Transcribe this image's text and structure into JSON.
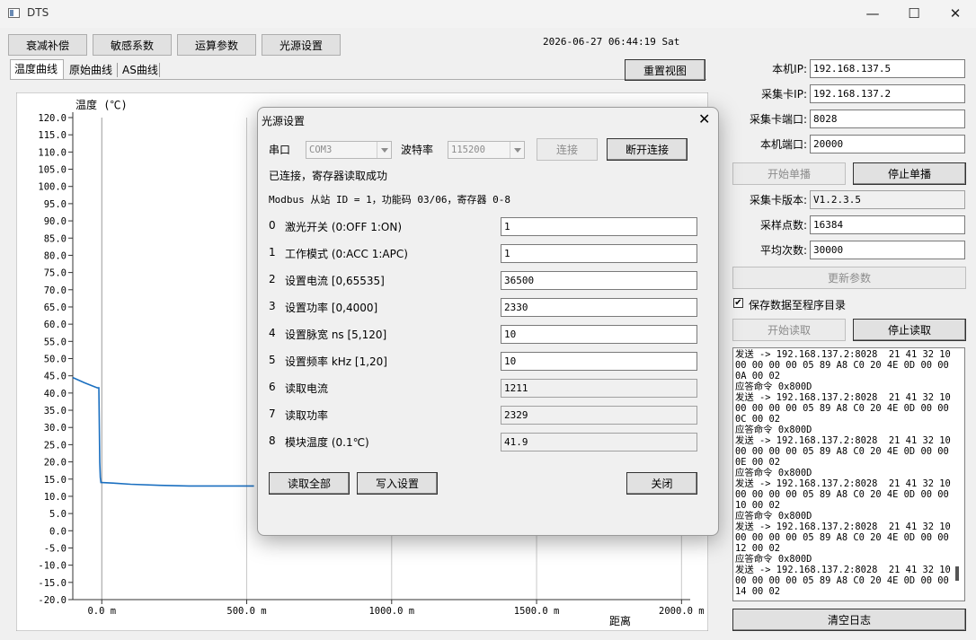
{
  "window": {
    "title": "DTS",
    "minimize": "—",
    "maximize": "☐",
    "close": "✕"
  },
  "toolbar": {
    "buttons": [
      "衰减补偿",
      "敏感系数",
      "运算参数",
      "光源设置"
    ],
    "datetime": "2026-06-27 06:44:19 Sat",
    "reset_view": "重置视图"
  },
  "tabs": [
    "温度曲线",
    "原始曲线",
    "AS曲线"
  ],
  "chart_data": {
    "type": "line",
    "ylabel": "温度 (℃)",
    "xlabel": "距离",
    "ylim": [
      -20,
      120
    ],
    "xlim": [
      -100,
      2030
    ],
    "yticks": [
      "120.0",
      "115.0",
      "110.0",
      "105.0",
      "100.0",
      "95.0",
      "90.0",
      "85.0",
      "80.0",
      "75.0",
      "70.0",
      "65.0",
      "60.0",
      "55.0",
      "50.0",
      "45.0",
      "40.0",
      "35.0",
      "30.0",
      "25.0",
      "20.0",
      "15.0",
      "10.0",
      "5.0",
      "0.0",
      "-5.0",
      "-10.0",
      "-15.0",
      "-20.0"
    ],
    "xticks": [
      {
        "value": 0,
        "label": "0.0 m"
      },
      {
        "value": 500,
        "label": "500.0 m"
      },
      {
        "value": 1000,
        "label": "1000.0 m"
      },
      {
        "value": 1500,
        "label": "1500.0 m"
      },
      {
        "value": 2000,
        "label": "2000.0 m"
      }
    ],
    "series_color": "#1a6fc0",
    "series": [
      {
        "x": [
          -100,
          -60,
          -30,
          -15,
          -10,
          -7,
          -5,
          -3,
          0,
          50,
          100,
          200,
          300,
          400,
          500,
          525
        ],
        "y": [
          44.5,
          43,
          42,
          41.5,
          41.5,
          20,
          15.5,
          14,
          14,
          13.8,
          13.5,
          13.2,
          13.0,
          13.0,
          13.0,
          13.0
        ]
      }
    ]
  },
  "right_panel": {
    "local_ip_label": "本机IP:",
    "local_ip": "192.168.137.5",
    "card_ip_label": "采集卡IP:",
    "card_ip": "192.168.137.2",
    "card_port_label": "采集卡端口:",
    "card_port": "8028",
    "local_port_label": "本机端口:",
    "local_port": "20000",
    "start_single": "开始单播",
    "stop_single": "停止单播",
    "card_version_label": "采集卡版本:",
    "card_version": "V1.2.3.5",
    "sample_points_label": "采样点数:",
    "sample_points": "16384",
    "avg_count_label": "平均次数:",
    "avg_count": "30000",
    "update_params": "更新参数",
    "save_checkbox_label": "保存数据至程序目录",
    "start_read": "开始读取",
    "stop_read": "停止读取",
    "log_lines": [
      "发送 -> 192.168.137.2:8028  21 41 32 10",
      "00 00 00 00 05 89 A8 C0 20 4E 0D 00 00",
      "0A 00 02",
      "应答命令 0x800D",
      "发送 -> 192.168.137.2:8028  21 41 32 10",
      "00 00 00 00 05 89 A8 C0 20 4E 0D 00 00",
      "0C 00 02",
      "应答命令 0x800D",
      "发送 -> 192.168.137.2:8028  21 41 32 10",
      "00 00 00 00 05 89 A8 C0 20 4E 0D 00 00",
      "0E 00 02",
      "应答命令 0x800D",
      "发送 -> 192.168.137.2:8028  21 41 32 10",
      "00 00 00 00 05 89 A8 C0 20 4E 0D 00 00",
      "10 00 02",
      "应答命令 0x800D",
      "发送 -> 192.168.137.2:8028  21 41 32 10",
      "00 00 00 00 05 89 A8 C0 20 4E 0D 00 00",
      "12 00 02",
      "应答命令 0x800D",
      "发送 -> 192.168.137.2:8028  21 41 32 10",
      "00 00 00 00 05 89 A8 C0 20 4E 0D 00 00",
      "14 00 02"
    ],
    "clear_log": "清空日志"
  },
  "dialog": {
    "title": "光源设置",
    "close_icon": "✕",
    "port_label": "串口",
    "port_value": "COM3",
    "baud_label": "波特率",
    "baud_value": "115200",
    "connect": "连接",
    "disconnect": "断开连接",
    "status": "已连接，寄存器读取成功",
    "modbus_info": "Modbus 从站 ID = 1，功能码 03/06，寄存器 0-8",
    "registers": [
      {
        "index": "0",
        "name": "激光开关 (0:OFF 1:ON)",
        "value": "1"
      },
      {
        "index": "1",
        "name": "工作模式 (0:ACC 1:APC)",
        "value": "1"
      },
      {
        "index": "2",
        "name": "设置电流 [0,65535]",
        "value": "36500"
      },
      {
        "index": "3",
        "name": "设置功率 [0,4000]",
        "value": "2330"
      },
      {
        "index": "4",
        "name": "设置脉宽 ns [5,120]",
        "value": "10"
      },
      {
        "index": "5",
        "name": "设置频率 kHz [1,20]",
        "value": "10"
      },
      {
        "index": "6",
        "name": "读取电流",
        "value": "1211"
      },
      {
        "index": "7",
        "name": "读取功率",
        "value": "2329"
      },
      {
        "index": "8",
        "name": "模块温度 (0.1℃)",
        "value": "41.9"
      }
    ],
    "read_all": "读取全部",
    "write_settings": "写入设置",
    "close": "关闭"
  }
}
